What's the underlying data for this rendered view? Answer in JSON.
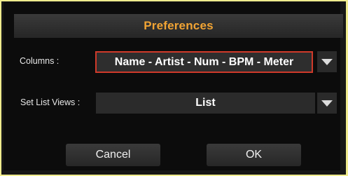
{
  "dialog": {
    "title": "Preferences",
    "columns": {
      "label": "Columns :",
      "value": "Name - Artist - Num - BPM - Meter",
      "selected": true
    },
    "set_list_views": {
      "label": "Set List Views :",
      "value": "List"
    },
    "buttons": {
      "cancel": "Cancel",
      "ok": "OK"
    }
  },
  "colors": {
    "title_accent": "#f1a434",
    "selection_border": "#d03a2a",
    "frame_background": "#f0ec8e"
  },
  "icons": {
    "dropdown": "triangle-down-icon"
  }
}
